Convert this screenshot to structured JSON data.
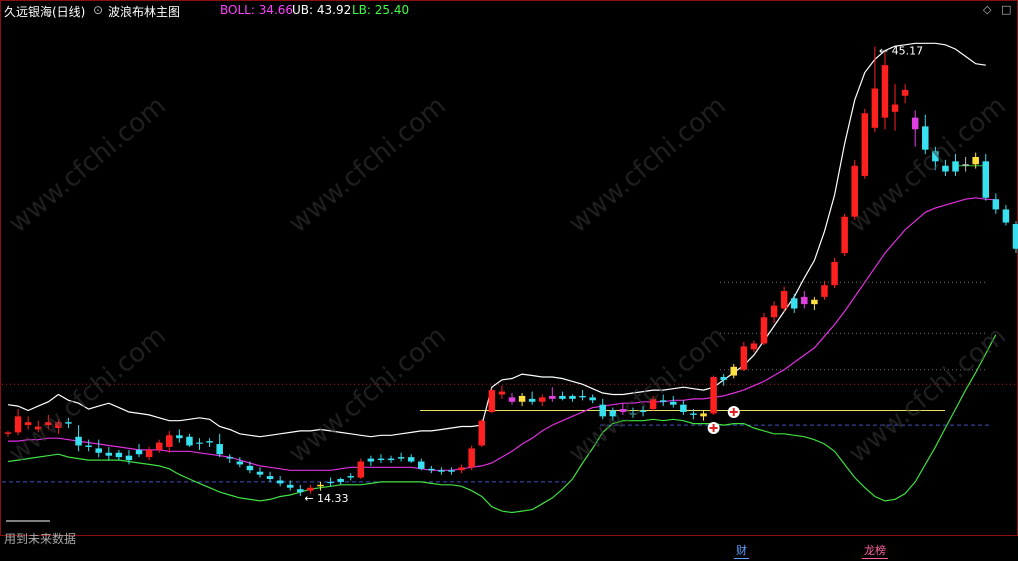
{
  "header": {
    "stock_name": "久远银海(日线)",
    "indicator_name": "波浪布林主图",
    "boll_label": "BOLL: 34.66",
    "ub_label": "UB: 43.92",
    "lb_label": "LB: 25.40"
  },
  "controls": {
    "diamond_icon": "◇",
    "menu_icon": "□"
  },
  "watermark": "www.cfchi.com",
  "annotations": {
    "high_label": "45.17",
    "low_label": "14.33",
    "future_data_note": "用到未来数据"
  },
  "badges": {
    "finance": "财",
    "ranking": "龙榜"
  },
  "colors": {
    "up": "#ff2020",
    "down": "#38e0f0",
    "mid": "#e030e0",
    "upper": "#ffffff",
    "lower": "#40e040",
    "yellow": "#ffe040",
    "magenta": "#e040e0",
    "orange": "#ff9020",
    "gray": "#c0c0c0"
  },
  "chart_data": {
    "type": "candlestick",
    "y_axis_range": [
      12,
      47
    ],
    "candles": [
      {
        "o": 18.6,
        "h": 18.8,
        "l": 18.4,
        "c": 18.7,
        "color": "red"
      },
      {
        "o": 19.8,
        "h": 20.3,
        "l": 18.5,
        "c": 18.7,
        "color": "red"
      },
      {
        "o": 19.4,
        "h": 19.8,
        "l": 18.9,
        "c": 19.2,
        "color": "red"
      },
      {
        "o": 19.1,
        "h": 19.5,
        "l": 18.7,
        "c": 18.9,
        "color": "red"
      },
      {
        "o": 19.4,
        "h": 19.9,
        "l": 18.9,
        "c": 19.2,
        "color": "red"
      },
      {
        "o": 19.0,
        "h": 19.6,
        "l": 18.6,
        "c": 19.4,
        "color": "red"
      },
      {
        "o": 19.4,
        "h": 19.7,
        "l": 19.0,
        "c": 19.3,
        "color": "cyan"
      },
      {
        "o": 18.4,
        "h": 19.2,
        "l": 17.4,
        "c": 17.8,
        "color": "cyan"
      },
      {
        "o": 17.8,
        "h": 18.2,
        "l": 17.4,
        "c": 17.7,
        "color": "cyan"
      },
      {
        "o": 17.6,
        "h": 18.2,
        "l": 17.0,
        "c": 17.3,
        "color": "cyan"
      },
      {
        "o": 17.3,
        "h": 17.7,
        "l": 16.8,
        "c": 17.1,
        "color": "cyan"
      },
      {
        "o": 17.0,
        "h": 17.5,
        "l": 16.8,
        "c": 17.3,
        "color": "cyan"
      },
      {
        "o": 17.1,
        "h": 17.5,
        "l": 16.5,
        "c": 16.8,
        "color": "cyan"
      },
      {
        "o": 17.5,
        "h": 17.9,
        "l": 17.0,
        "c": 17.2,
        "color": "cyan"
      },
      {
        "o": 17.0,
        "h": 17.7,
        "l": 16.8,
        "c": 17.5,
        "color": "red"
      },
      {
        "o": 17.5,
        "h": 18.2,
        "l": 17.3,
        "c": 18.0,
        "color": "red"
      },
      {
        "o": 17.7,
        "h": 18.8,
        "l": 17.3,
        "c": 18.5,
        "color": "red"
      },
      {
        "o": 18.5,
        "h": 18.9,
        "l": 18.0,
        "c": 18.3,
        "color": "cyan"
      },
      {
        "o": 18.4,
        "h": 18.6,
        "l": 17.7,
        "c": 17.8,
        "color": "cyan"
      },
      {
        "o": 18.0,
        "h": 18.3,
        "l": 17.5,
        "c": 18.0,
        "color": "cyan"
      },
      {
        "o": 18.0,
        "h": 18.3,
        "l": 17.7,
        "c": 18.1,
        "color": "cyan"
      },
      {
        "o": 17.9,
        "h": 18.6,
        "l": 17.0,
        "c": 17.2,
        "color": "cyan"
      },
      {
        "o": 17.0,
        "h": 17.2,
        "l": 16.6,
        "c": 16.9,
        "color": "cyan"
      },
      {
        "o": 16.7,
        "h": 17.0,
        "l": 16.3,
        "c": 16.5,
        "color": "cyan"
      },
      {
        "o": 16.4,
        "h": 16.7,
        "l": 15.9,
        "c": 16.1,
        "color": "cyan"
      },
      {
        "o": 16.0,
        "h": 16.3,
        "l": 15.6,
        "c": 15.8,
        "color": "cyan"
      },
      {
        "o": 15.7,
        "h": 16.0,
        "l": 15.3,
        "c": 15.5,
        "color": "cyan"
      },
      {
        "o": 15.4,
        "h": 15.7,
        "l": 15.0,
        "c": 15.2,
        "color": "cyan"
      },
      {
        "o": 15.1,
        "h": 15.4,
        "l": 14.7,
        "c": 14.9,
        "color": "cyan"
      },
      {
        "o": 14.8,
        "h": 15.1,
        "l": 14.33,
        "c": 14.6,
        "color": "cyan"
      },
      {
        "o": 14.7,
        "h": 15.1,
        "l": 14.5,
        "c": 14.9,
        "color": "red"
      },
      {
        "o": 15.0,
        "h": 15.3,
        "l": 14.7,
        "c": 15.1,
        "color": "yellow"
      },
      {
        "o": 15.3,
        "h": 15.6,
        "l": 15.0,
        "c": 15.3,
        "color": "cyan"
      },
      {
        "o": 15.3,
        "h": 15.6,
        "l": 15.1,
        "c": 15.5,
        "color": "cyan"
      },
      {
        "o": 15.6,
        "h": 15.9,
        "l": 15.4,
        "c": 15.7,
        "color": "cyan"
      },
      {
        "o": 15.6,
        "h": 16.9,
        "l": 15.5,
        "c": 16.7,
        "color": "red"
      },
      {
        "o": 16.7,
        "h": 17.1,
        "l": 16.4,
        "c": 16.9,
        "color": "cyan"
      },
      {
        "o": 16.9,
        "h": 17.2,
        "l": 16.6,
        "c": 16.8,
        "color": "cyan"
      },
      {
        "o": 16.8,
        "h": 17.1,
        "l": 16.6,
        "c": 16.9,
        "color": "cyan"
      },
      {
        "o": 16.9,
        "h": 17.3,
        "l": 16.7,
        "c": 17.0,
        "color": "cyan"
      },
      {
        "o": 17.0,
        "h": 17.2,
        "l": 16.6,
        "c": 16.7,
        "color": "cyan"
      },
      {
        "o": 16.7,
        "h": 16.9,
        "l": 16.1,
        "c": 16.2,
        "color": "cyan"
      },
      {
        "o": 16.2,
        "h": 16.4,
        "l": 15.9,
        "c": 16.1,
        "color": "cyan"
      },
      {
        "o": 16.1,
        "h": 16.3,
        "l": 15.8,
        "c": 16.0,
        "color": "cyan"
      },
      {
        "o": 16.0,
        "h": 16.3,
        "l": 15.8,
        "c": 16.1,
        "color": "cyan"
      },
      {
        "o": 16.1,
        "h": 16.5,
        "l": 15.9,
        "c": 16.3,
        "color": "red"
      },
      {
        "o": 16.3,
        "h": 17.8,
        "l": 16.1,
        "c": 17.6,
        "color": "red"
      },
      {
        "o": 17.8,
        "h": 19.6,
        "l": 17.7,
        "c": 19.5,
        "color": "red"
      },
      {
        "o": 20.1,
        "h": 21.7,
        "l": 20.0,
        "c": 21.6,
        "color": "red"
      },
      {
        "o": 21.5,
        "h": 21.9,
        "l": 21.0,
        "c": 21.3,
        "color": "red"
      },
      {
        "o": 21.1,
        "h": 21.4,
        "l": 20.6,
        "c": 20.8,
        "color": "magenta"
      },
      {
        "o": 20.8,
        "h": 21.4,
        "l": 20.5,
        "c": 21.2,
        "color": "yellow"
      },
      {
        "o": 21.0,
        "h": 21.5,
        "l": 20.6,
        "c": 20.8,
        "color": "cyan"
      },
      {
        "o": 20.8,
        "h": 21.3,
        "l": 20.5,
        "c": 21.1,
        "color": "red"
      },
      {
        "o": 21.0,
        "h": 21.8,
        "l": 20.8,
        "c": 21.2,
        "color": "magenta"
      },
      {
        "o": 21.2,
        "h": 21.5,
        "l": 20.9,
        "c": 21.0,
        "color": "cyan"
      },
      {
        "o": 21.0,
        "h": 21.3,
        "l": 20.8,
        "c": 21.2,
        "color": "cyan"
      },
      {
        "o": 21.2,
        "h": 21.6,
        "l": 20.9,
        "c": 21.1,
        "color": "cyan"
      },
      {
        "o": 21.1,
        "h": 21.3,
        "l": 20.7,
        "c": 20.9,
        "color": "cyan"
      },
      {
        "o": 20.6,
        "h": 21.0,
        "l": 19.6,
        "c": 19.8,
        "color": "cyan"
      },
      {
        "o": 19.8,
        "h": 20.4,
        "l": 19.5,
        "c": 20.2,
        "color": "cyan"
      },
      {
        "o": 20.3,
        "h": 20.7,
        "l": 19.9,
        "c": 20.1,
        "color": "magenta"
      },
      {
        "o": 20.0,
        "h": 20.4,
        "l": 19.7,
        "c": 20.0,
        "color": "cyan"
      },
      {
        "o": 20.1,
        "h": 20.5,
        "l": 19.8,
        "c": 20.2,
        "color": "cyan"
      },
      {
        "o": 20.3,
        "h": 21.2,
        "l": 20.2,
        "c": 21.0,
        "color": "red"
      },
      {
        "o": 20.8,
        "h": 21.3,
        "l": 20.5,
        "c": 20.9,
        "color": "cyan"
      },
      {
        "o": 20.8,
        "h": 21.2,
        "l": 20.4,
        "c": 20.6,
        "color": "cyan"
      },
      {
        "o": 20.6,
        "h": 20.9,
        "l": 19.9,
        "c": 20.1,
        "color": "cyan"
      },
      {
        "o": 19.9,
        "h": 20.3,
        "l": 19.6,
        "c": 20.0,
        "color": "cyan"
      },
      {
        "o": 19.8,
        "h": 20.2,
        "l": 19.5,
        "c": 20.0,
        "color": "yellow"
      },
      {
        "o": 20.0,
        "h": 22.6,
        "l": 19.9,
        "c": 22.5,
        "color": "red"
      },
      {
        "o": 22.3,
        "h": 22.7,
        "l": 21.9,
        "c": 22.5,
        "color": "cyan"
      },
      {
        "o": 22.6,
        "h": 23.4,
        "l": 22.4,
        "c": 23.2,
        "color": "yellow"
      },
      {
        "o": 23.0,
        "h": 24.9,
        "l": 22.9,
        "c": 24.6,
        "color": "red"
      },
      {
        "o": 24.4,
        "h": 25.0,
        "l": 24.2,
        "c": 24.8,
        "color": "red"
      },
      {
        "o": 24.8,
        "h": 26.9,
        "l": 24.7,
        "c": 26.6,
        "color": "red"
      },
      {
        "o": 26.6,
        "h": 27.7,
        "l": 26.2,
        "c": 27.4,
        "color": "red"
      },
      {
        "o": 27.2,
        "h": 28.7,
        "l": 27.0,
        "c": 28.4,
        "color": "red"
      },
      {
        "o": 27.9,
        "h": 28.2,
        "l": 26.9,
        "c": 27.2,
        "color": "cyan"
      },
      {
        "o": 27.5,
        "h": 28.4,
        "l": 27.2,
        "c": 28.0,
        "color": "magenta"
      },
      {
        "o": 27.5,
        "h": 28.0,
        "l": 27.1,
        "c": 27.8,
        "color": "yellow"
      },
      {
        "o": 28.0,
        "h": 29.1,
        "l": 27.8,
        "c": 28.8,
        "color": "red"
      },
      {
        "o": 28.8,
        "h": 30.7,
        "l": 28.6,
        "c": 30.4,
        "color": "red"
      },
      {
        "o": 31.0,
        "h": 33.7,
        "l": 30.8,
        "c": 33.5,
        "color": "red"
      },
      {
        "o": 33.5,
        "h": 37.4,
        "l": 33.3,
        "c": 37.0,
        "color": "red"
      },
      {
        "o": 36.3,
        "h": 40.9,
        "l": 36.1,
        "c": 40.6,
        "color": "red"
      },
      {
        "o": 39.6,
        "h": 45.17,
        "l": 39.3,
        "c": 42.3,
        "color": "red"
      },
      {
        "o": 43.9,
        "h": 44.8,
        "l": 39.5,
        "c": 40.3,
        "color": "red"
      },
      {
        "o": 40.7,
        "h": 42.6,
        "l": 39.4,
        "c": 41.2,
        "color": "red"
      },
      {
        "o": 42.2,
        "h": 42.6,
        "l": 41.3,
        "c": 41.8,
        "color": "red"
      },
      {
        "o": 40.3,
        "h": 40.8,
        "l": 38.3,
        "c": 39.5,
        "color": "magenta"
      },
      {
        "o": 39.7,
        "h": 40.5,
        "l": 37.8,
        "c": 38.1,
        "color": "cyan"
      },
      {
        "o": 38.0,
        "h": 38.3,
        "l": 36.7,
        "c": 37.3,
        "color": "cyan"
      },
      {
        "o": 37.0,
        "h": 37.4,
        "l": 36.3,
        "c": 36.6,
        "color": "cyan"
      },
      {
        "o": 37.3,
        "h": 37.8,
        "l": 36.3,
        "c": 36.6,
        "color": "cyan"
      },
      {
        "o": 37.1,
        "h": 37.6,
        "l": 36.6,
        "c": 37.0,
        "color": "gray"
      },
      {
        "o": 37.6,
        "h": 37.9,
        "l": 36.8,
        "c": 37.1,
        "color": "yellow"
      },
      {
        "o": 37.3,
        "h": 37.8,
        "l": 34.6,
        "c": 34.8,
        "color": "cyan"
      },
      {
        "o": 34.7,
        "h": 35.1,
        "l": 33.7,
        "c": 34.0,
        "color": "cyan"
      },
      {
        "o": 34.0,
        "h": 34.3,
        "l": 32.9,
        "c": 33.1,
        "color": "cyan"
      },
      {
        "o": 33.0,
        "h": 33.2,
        "l": 31.0,
        "c": 31.3,
        "color": "cyan"
      }
    ],
    "upper_band": [
      20.6,
      20.5,
      20.2,
      20.5,
      20.8,
      21.3,
      20.9,
      20.7,
      20.3,
      20.5,
      20.7,
      20.4,
      20.1,
      20.0,
      19.9,
      19.7,
      19.5,
      19.5,
      19.6,
      19.7,
      19.6,
      19.1,
      18.9,
      18.6,
      18.5,
      18.4,
      18.5,
      18.6,
      18.7,
      18.8,
      18.8,
      18.9,
      18.8,
      18.7,
      18.6,
      18.5,
      18.4,
      18.5,
      18.5,
      18.6,
      18.7,
      18.8,
      18.8,
      18.9,
      19.0,
      19.1,
      19.1,
      19.2,
      21.8,
      22.3,
      22.4,
      22.7,
      22.6,
      22.5,
      22.5,
      22.4,
      22.2,
      22.0,
      21.7,
      21.4,
      21.3,
      21.3,
      21.4,
      21.5,
      21.6,
      21.6,
      21.7,
      21.8,
      21.7,
      21.6,
      21.8,
      22.3,
      22.8,
      23.3,
      24.0,
      25.0,
      26.0,
      27.0,
      28.0,
      29.3,
      30.5,
      32.5,
      35.0,
      38.5,
      41.5,
      43.4,
      44.3,
      44.9,
      45.2,
      45.3,
      45.4,
      45.4,
      45.4,
      45.3,
      45.0,
      44.5,
      44.0,
      43.9
    ],
    "mid_band": [
      18.1,
      18.1,
      18.2,
      18.2,
      18.3,
      18.3,
      18.2,
      18.1,
      18.0,
      17.9,
      17.8,
      17.7,
      17.6,
      17.5,
      17.5,
      17.5,
      17.4,
      17.4,
      17.4,
      17.3,
      17.2,
      17.1,
      17.0,
      16.8,
      16.6,
      16.4,
      16.3,
      16.2,
      16.1,
      16.1,
      16.1,
      16.1,
      16.1,
      16.2,
      16.3,
      16.3,
      16.3,
      16.3,
      16.3,
      16.3,
      16.3,
      16.2,
      16.1,
      16.1,
      16.1,
      16.2,
      16.3,
      16.4,
      16.6,
      17.0,
      17.4,
      17.9,
      18.3,
      18.8,
      19.2,
      19.5,
      19.8,
      20.1,
      20.4,
      20.5,
      20.6,
      20.7,
      20.7,
      20.8,
      20.8,
      20.8,
      20.9,
      20.9,
      21.0,
      21.0,
      21.1,
      21.2,
      21.4,
      21.6,
      21.9,
      22.2,
      22.6,
      23.0,
      23.5,
      24.0,
      24.5,
      25.3,
      26.1,
      27.0,
      28.0,
      29.0,
      30.0,
      31.0,
      31.8,
      32.6,
      33.2,
      33.8,
      34.1,
      34.3,
      34.5,
      34.7,
      34.8,
      34.7,
      34.66
    ],
    "lower_band": [
      16.7,
      16.8,
      16.9,
      17.0,
      17.1,
      17.2,
      17.0,
      16.9,
      16.8,
      16.8,
      16.8,
      16.8,
      16.7,
      16.6,
      16.5,
      16.4,
      16.2,
      15.8,
      15.5,
      15.2,
      14.9,
      14.6,
      14.4,
      14.2,
      14.1,
      14.0,
      14.1,
      14.3,
      14.4,
      14.6,
      14.8,
      14.9,
      15.0,
      15.1,
      15.1,
      15.1,
      15.2,
      15.3,
      15.3,
      15.3,
      15.3,
      15.3,
      15.2,
      15.1,
      15.1,
      15.0,
      14.7,
      14.3,
      13.6,
      13.3,
      13.2,
      13.3,
      13.4,
      13.8,
      14.2,
      14.8,
      15.5,
      16.6,
      17.6,
      18.7,
      19.3,
      19.5,
      19.5,
      19.5,
      19.6,
      19.5,
      19.6,
      19.5,
      19.3,
      19.3,
      19.3,
      19.2,
      19.3,
      19.3,
      19.0,
      18.8,
      18.6,
      18.6,
      18.5,
      18.4,
      18.2,
      17.9,
      17.4,
      16.5,
      15.6,
      14.9,
      14.3,
      14.0,
      14.1,
      14.5,
      15.3,
      16.5,
      17.7,
      19.0,
      20.3,
      21.6,
      22.8,
      24.1,
      25.4
    ],
    "reference_levels": [
      {
        "value": 22.0,
        "style": "red-dotted"
      },
      {
        "value": 20.2,
        "style": "yellow-solid"
      },
      {
        "value": 19.2,
        "style": "navy-dashed"
      },
      {
        "value": 15.3,
        "style": "navy-dashed"
      },
      {
        "value": 29.0,
        "style": "gray-dotted"
      },
      {
        "value": 25.5,
        "style": "gray-dotted"
      },
      {
        "value": 23.0,
        "style": "gray-dotted"
      },
      {
        "value": 37.0,
        "style": "green-solid"
      }
    ],
    "buy_signals": [
      {
        "index": 70,
        "price": 19.0
      },
      {
        "index": 72,
        "price": 20.1
      }
    ]
  }
}
